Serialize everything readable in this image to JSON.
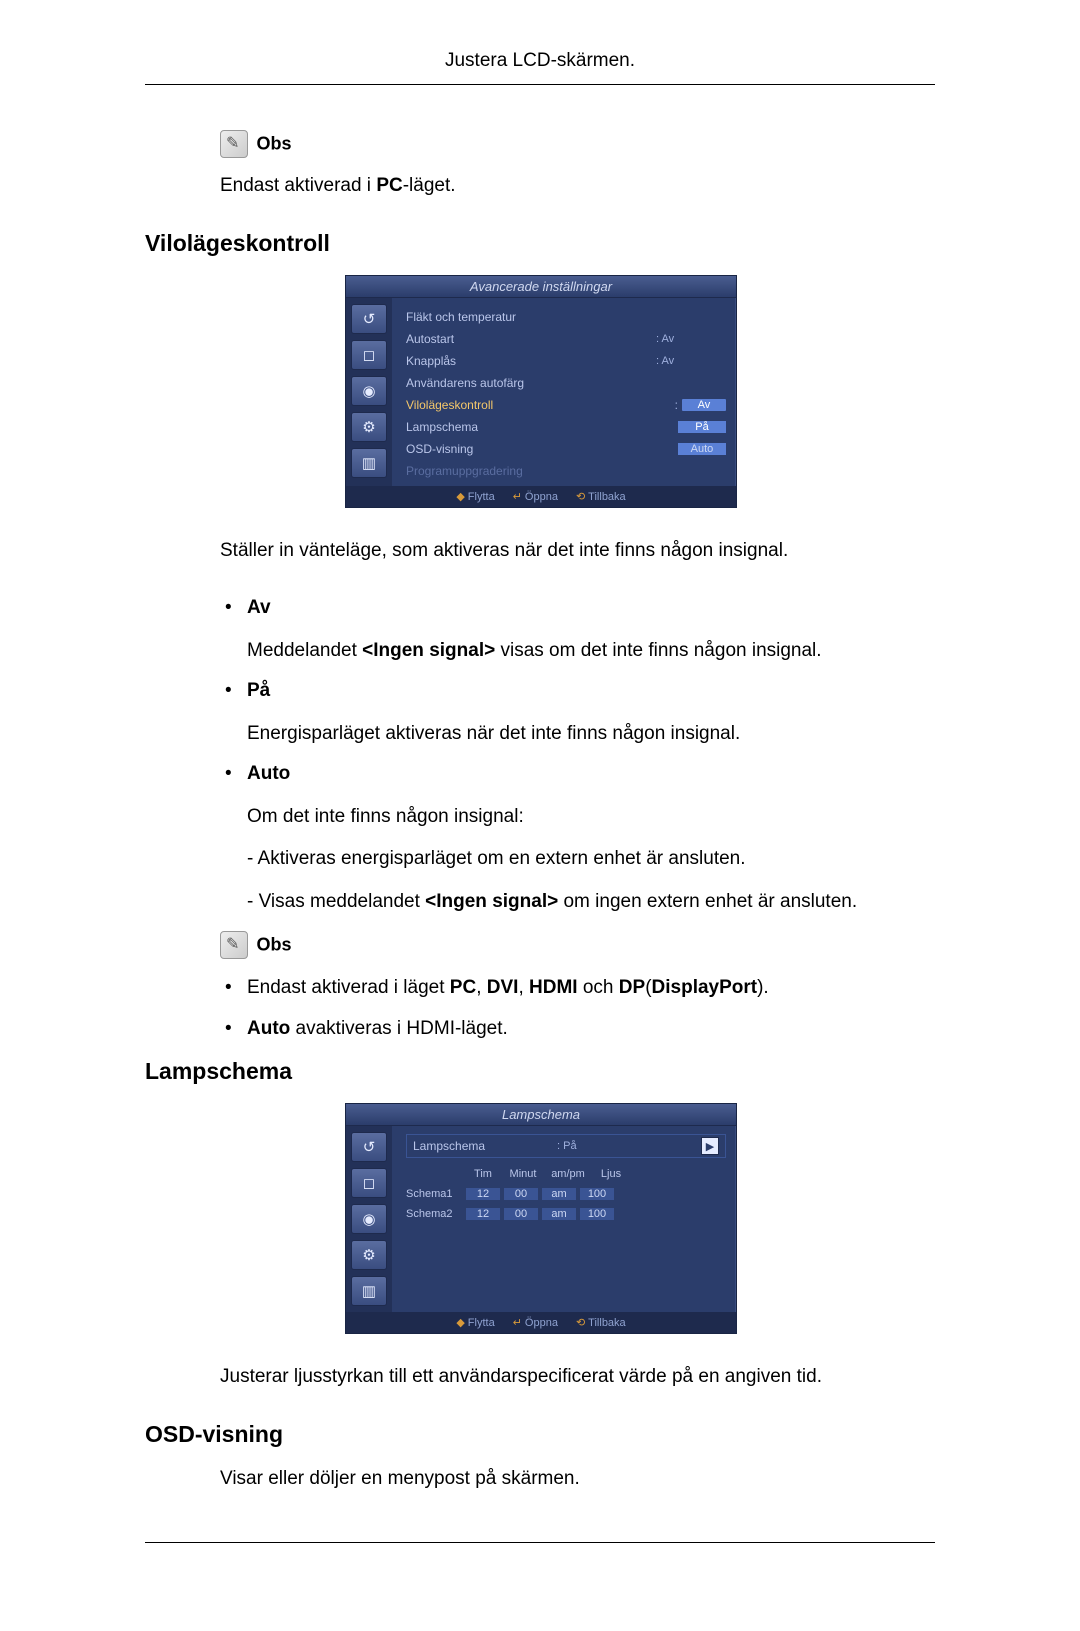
{
  "header": {
    "title": "Justera LCD-skärmen."
  },
  "note_label": "Obs",
  "section1": {
    "text": "Endast aktiverad i ",
    "bold": "PC",
    "suffix": "-läget."
  },
  "sleep": {
    "heading": "Vilolägeskontroll",
    "intro": "Ställer in vänteläge, som aktiveras när det inte finns någon insignal.",
    "items": {
      "av": {
        "title": "Av",
        "desc_pre": "Meddelandet ",
        "desc_bold": "<Ingen signal>",
        "desc_post": " visas om det inte finns någon insignal."
      },
      "pa": {
        "title": "På",
        "desc": "Energisparläget aktiveras när det inte finns någon insignal."
      },
      "auto": {
        "title": "Auto",
        "desc": "Om det inte finns någon insignal:",
        "sub1": "- Aktiveras energisparläget om en extern enhet är ansluten.",
        "sub2_pre": "- Visas meddelandet ",
        "sub2_bold": "<Ingen signal>",
        "sub2_post": " om ingen extern enhet är ansluten."
      }
    },
    "note": {
      "line1_pre": "Endast aktiverad i läget ",
      "line1_b1": "PC",
      "line1_s1": ", ",
      "line1_b2": "DVI",
      "line1_s2": ", ",
      "line1_b3": "HDMI",
      "line1_s3": " och ",
      "line1_b4": "DP",
      "line1_s4": "(",
      "line1_b5": "DisplayPort",
      "line1_s5": ").",
      "line2_b": "Auto",
      "line2_rest": " avaktiveras i HDMI-läget."
    }
  },
  "osd1": {
    "title": "Avancerade inställningar",
    "rows": [
      {
        "label": "Fläkt och temperatur",
        "val": ""
      },
      {
        "label": "Autostart",
        "val": ": Av"
      },
      {
        "label": "Knapplås",
        "val": ": Av"
      },
      {
        "label": "Användarens autofärg",
        "val": ""
      },
      {
        "label": "Vilolägeskontroll",
        "val": "Av",
        "hl": true,
        "colon": ":"
      },
      {
        "label": "Lampschema",
        "val": "På",
        "hlval": true
      },
      {
        "label": "OSD-visning",
        "val": "Auto",
        "hlval": true
      },
      {
        "label": "Programuppgradering",
        "val": "",
        "dim": true
      }
    ],
    "footer": {
      "move": "Flytta",
      "open": "Öppna",
      "back": "Tillbaka"
    }
  },
  "lamp": {
    "heading": "Lampschema",
    "desc": "Justerar ljusstyrkan till ett användarspecificerat värde på en angiven tid."
  },
  "osd2": {
    "title": "Lampschema",
    "mainrow": {
      "label": "Lampschema",
      "val": ": På"
    },
    "cols": {
      "tim": "Tim",
      "minut": "Minut",
      "ampm": "am/pm",
      "ljus": "Ljus"
    },
    "rows": [
      {
        "name": "Schema1",
        "tim": "12",
        "minut": "00",
        "ampm": "am",
        "ljus": "100"
      },
      {
        "name": "Schema2",
        "tim": "12",
        "minut": "00",
        "ampm": "am",
        "ljus": "100"
      }
    ],
    "footer": {
      "move": "Flytta",
      "open": "Öppna",
      "back": "Tillbaka"
    }
  },
  "osdview": {
    "heading": "OSD-visning",
    "desc": "Visar eller döljer en menypost på skärmen."
  }
}
